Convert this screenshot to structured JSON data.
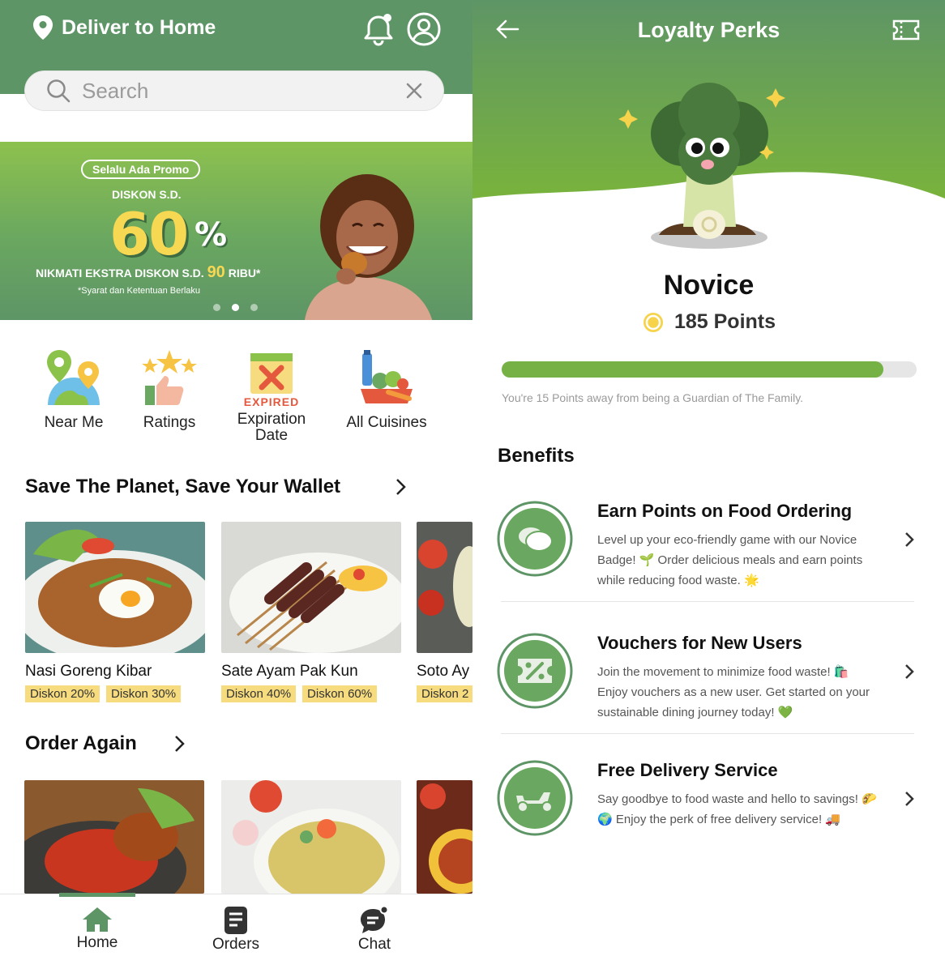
{
  "left": {
    "header": {
      "deliver_label": "Deliver to Home",
      "icons": [
        "location-pin-icon",
        "bell-icon",
        "profile-icon"
      ]
    },
    "search": {
      "placeholder": "Search",
      "value": ""
    },
    "banner": {
      "pill": "Selalu Ada Promo",
      "diskon_sd": "DISKON S.D.",
      "percent": "60",
      "percent_sign": "%",
      "nikmati_prefix": "NIKMATI EKSTRA DISKON S.D.",
      "nikmati_amount": "90",
      "nikmati_suffix": "RIBU*",
      "terms": "*Syarat dan Ketentuan Berlaku",
      "slide_count": 3,
      "active_slide": 2
    },
    "categories": [
      {
        "label": "Near Me",
        "icon": "map-pins-icon"
      },
      {
        "label": "Ratings",
        "icon": "stars-thumb-icon"
      },
      {
        "label": "Expiration",
        "label2": "Date",
        "icon": "expired-calendar-icon",
        "icon_text": "EXPIRED"
      },
      {
        "label": "All Cuisines",
        "icon": "food-basket-icon"
      }
    ],
    "save_section": {
      "title": "Save The Planet, Save Your Wallet",
      "items": [
        {
          "name": "Nasi Goreng Kibar",
          "discounts": [
            "Diskon 20%",
            "Diskon 30%"
          ]
        },
        {
          "name": "Sate Ayam Pak Kun",
          "discounts": [
            "Diskon 40%",
            "Diskon 60%"
          ]
        },
        {
          "name": "Soto Ay",
          "discounts": [
            "Diskon 2"
          ]
        }
      ]
    },
    "order_again": {
      "title": "Order Again"
    },
    "nav": [
      {
        "label": "Home",
        "icon": "home-icon",
        "active": true
      },
      {
        "label": "Orders",
        "icon": "receipt-icon",
        "active": false
      },
      {
        "label": "Chat",
        "icon": "chat-icon",
        "active": false
      }
    ]
  },
  "right": {
    "title": "Loyalty Perks",
    "tier": "Novice",
    "points_label": "185 Points",
    "progress": 0.92,
    "progress_note": "You're 15 Points away from being a Guardian of The Family.",
    "benefits_heading": "Benefits",
    "benefits": [
      {
        "title": "Earn Points on Food Ordering",
        "desc": "Level up your eco-friendly game with our Novice Badge! 🌱 Order delicious meals and earn points while reducing food waste. 🌟",
        "icon": "coins-icon"
      },
      {
        "title": "Vouchers for New Users",
        "desc": "Join the movement to minimize food waste! 🛍️ Enjoy vouchers as a new user. Get started on your sustainable dining journey today! 💚",
        "icon": "voucher-percent-icon"
      },
      {
        "title": "Free Delivery Service",
        "desc": "Say goodbye to food waste and hello to savings! 🌮🌍 Enjoy the perk of free delivery service! 🚚",
        "icon": "scooter-icon"
      }
    ],
    "colors": {
      "primary": "#5e9566",
      "accent": "#76b146",
      "badge": "#f6dc7e"
    }
  }
}
